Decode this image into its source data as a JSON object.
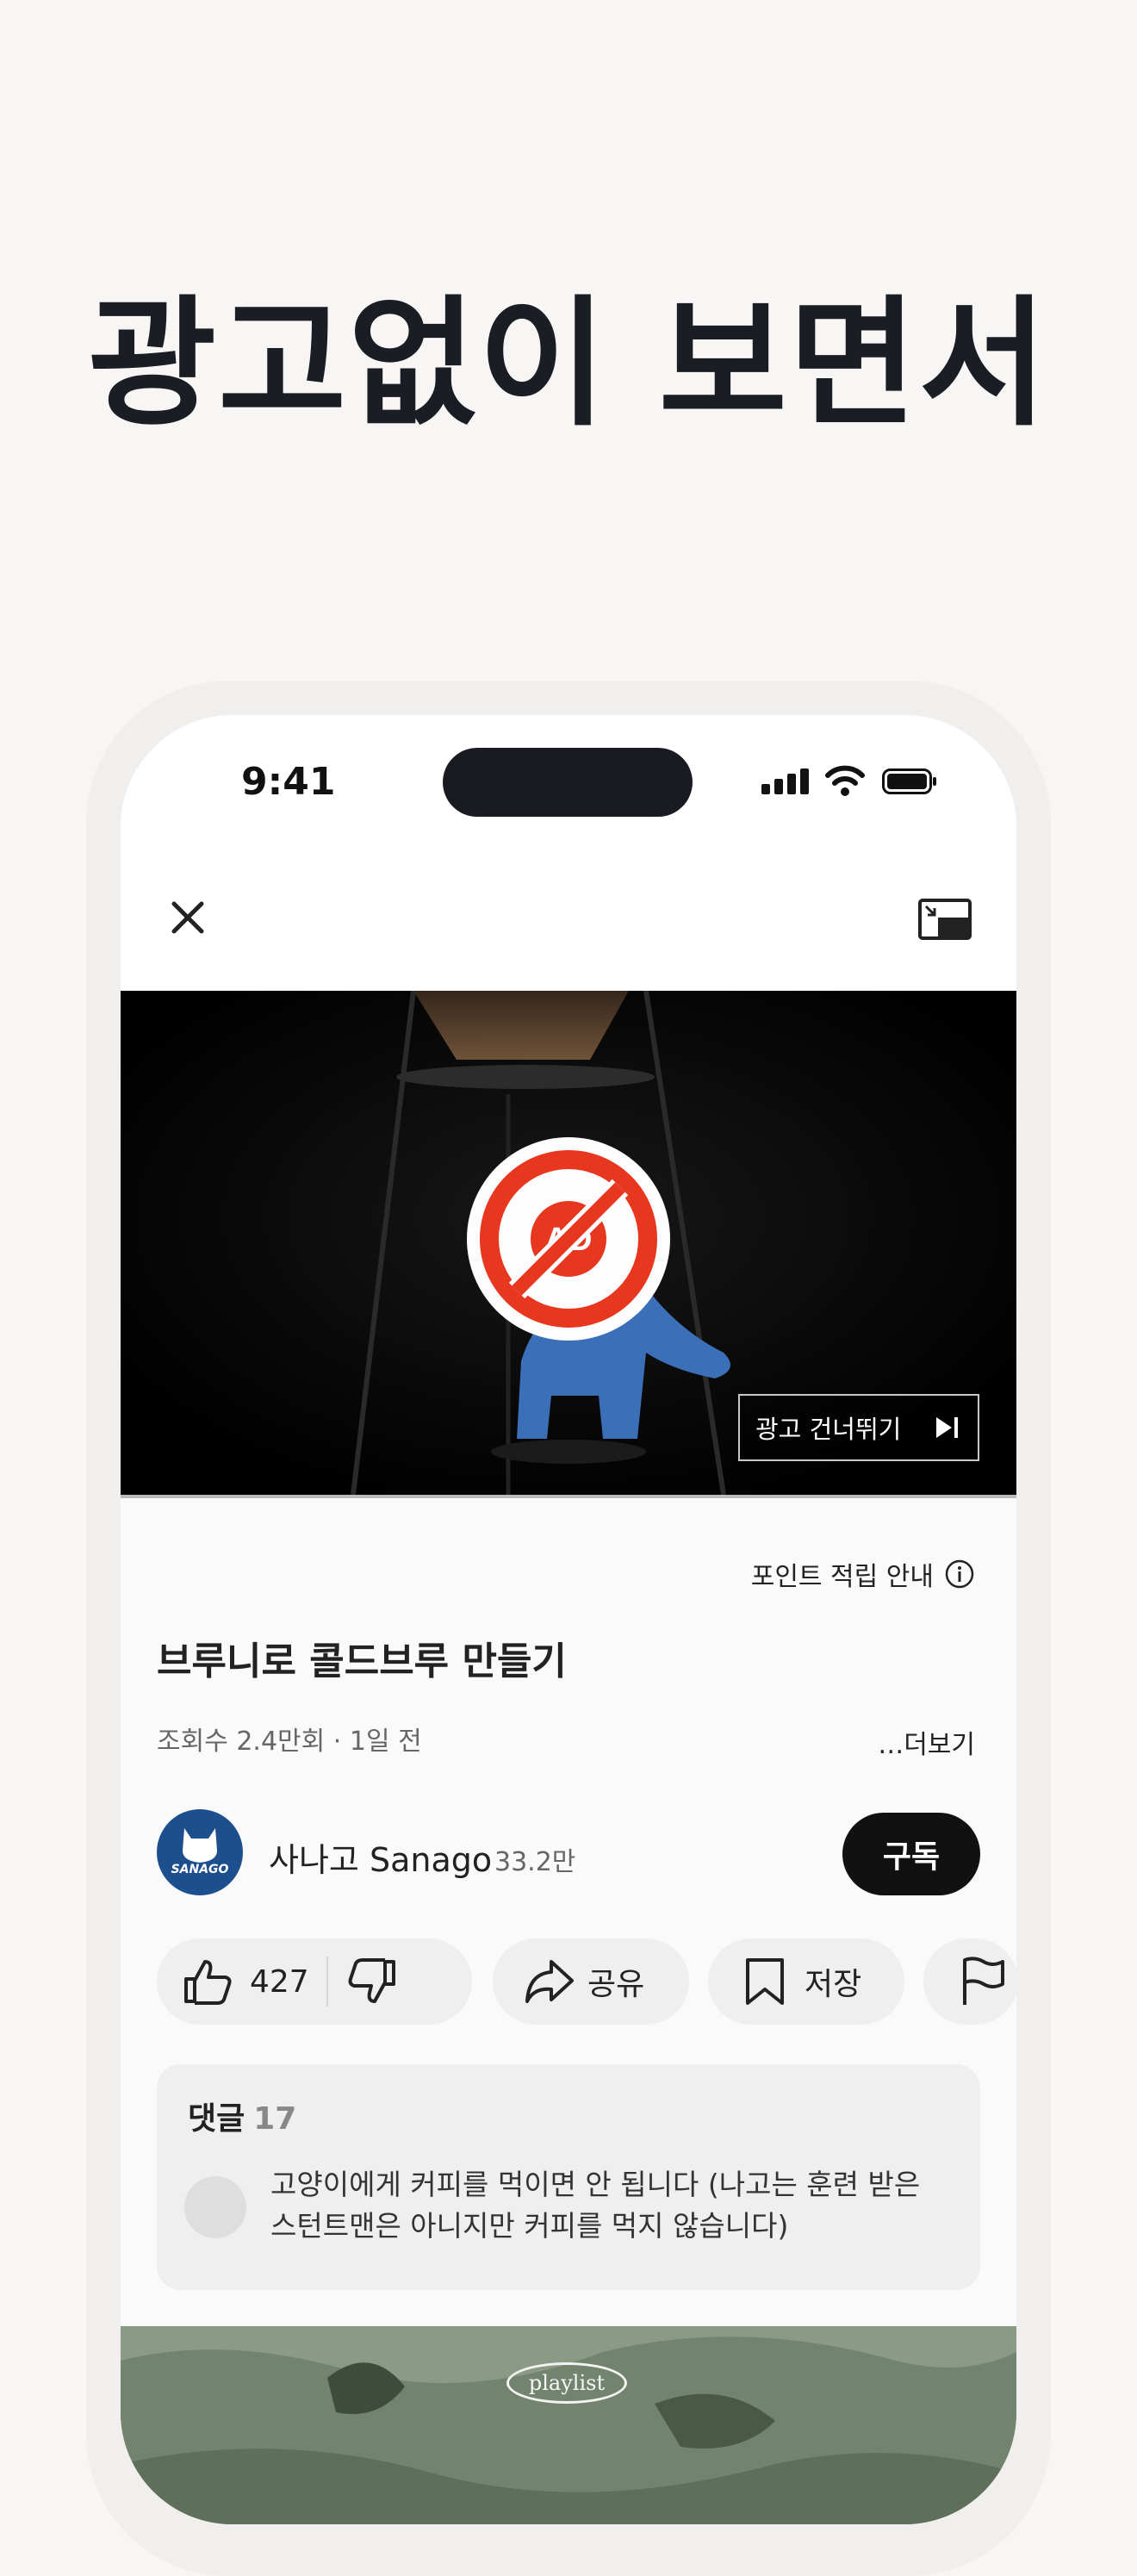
{
  "headline": "광고없이 보면서",
  "status_bar": {
    "time": "9:41"
  },
  "video": {
    "ad_label": "AD",
    "skip_label": "광고 건너뛰기"
  },
  "points_label": "포인트 적립 안내",
  "title": "브루니로 콜드브루 만들기",
  "meta": "조회수 2.4만회 · 1일 전",
  "more_label": "…더보기",
  "channel": {
    "name": "사나고 Sanago",
    "subscribers": "33.2만",
    "avatar_text": "SANAGO",
    "subscribe_label": "구독"
  },
  "actions": {
    "like_count": "427",
    "share_label": "공유",
    "save_label": "저장"
  },
  "comments": {
    "label": "댓글",
    "count": "17",
    "first": "고양이에게 커피를 먹이면 안 됩니다 (나고는 훈련 받은 스턴트맨은 아니지만 커피를 먹지 않습니다)"
  },
  "next_video": {
    "tag": "playlist"
  },
  "colors": {
    "background": "#f8f6f5",
    "ad_red": "#e8371f",
    "subscribe": "#111111",
    "pill": "#efefef"
  }
}
